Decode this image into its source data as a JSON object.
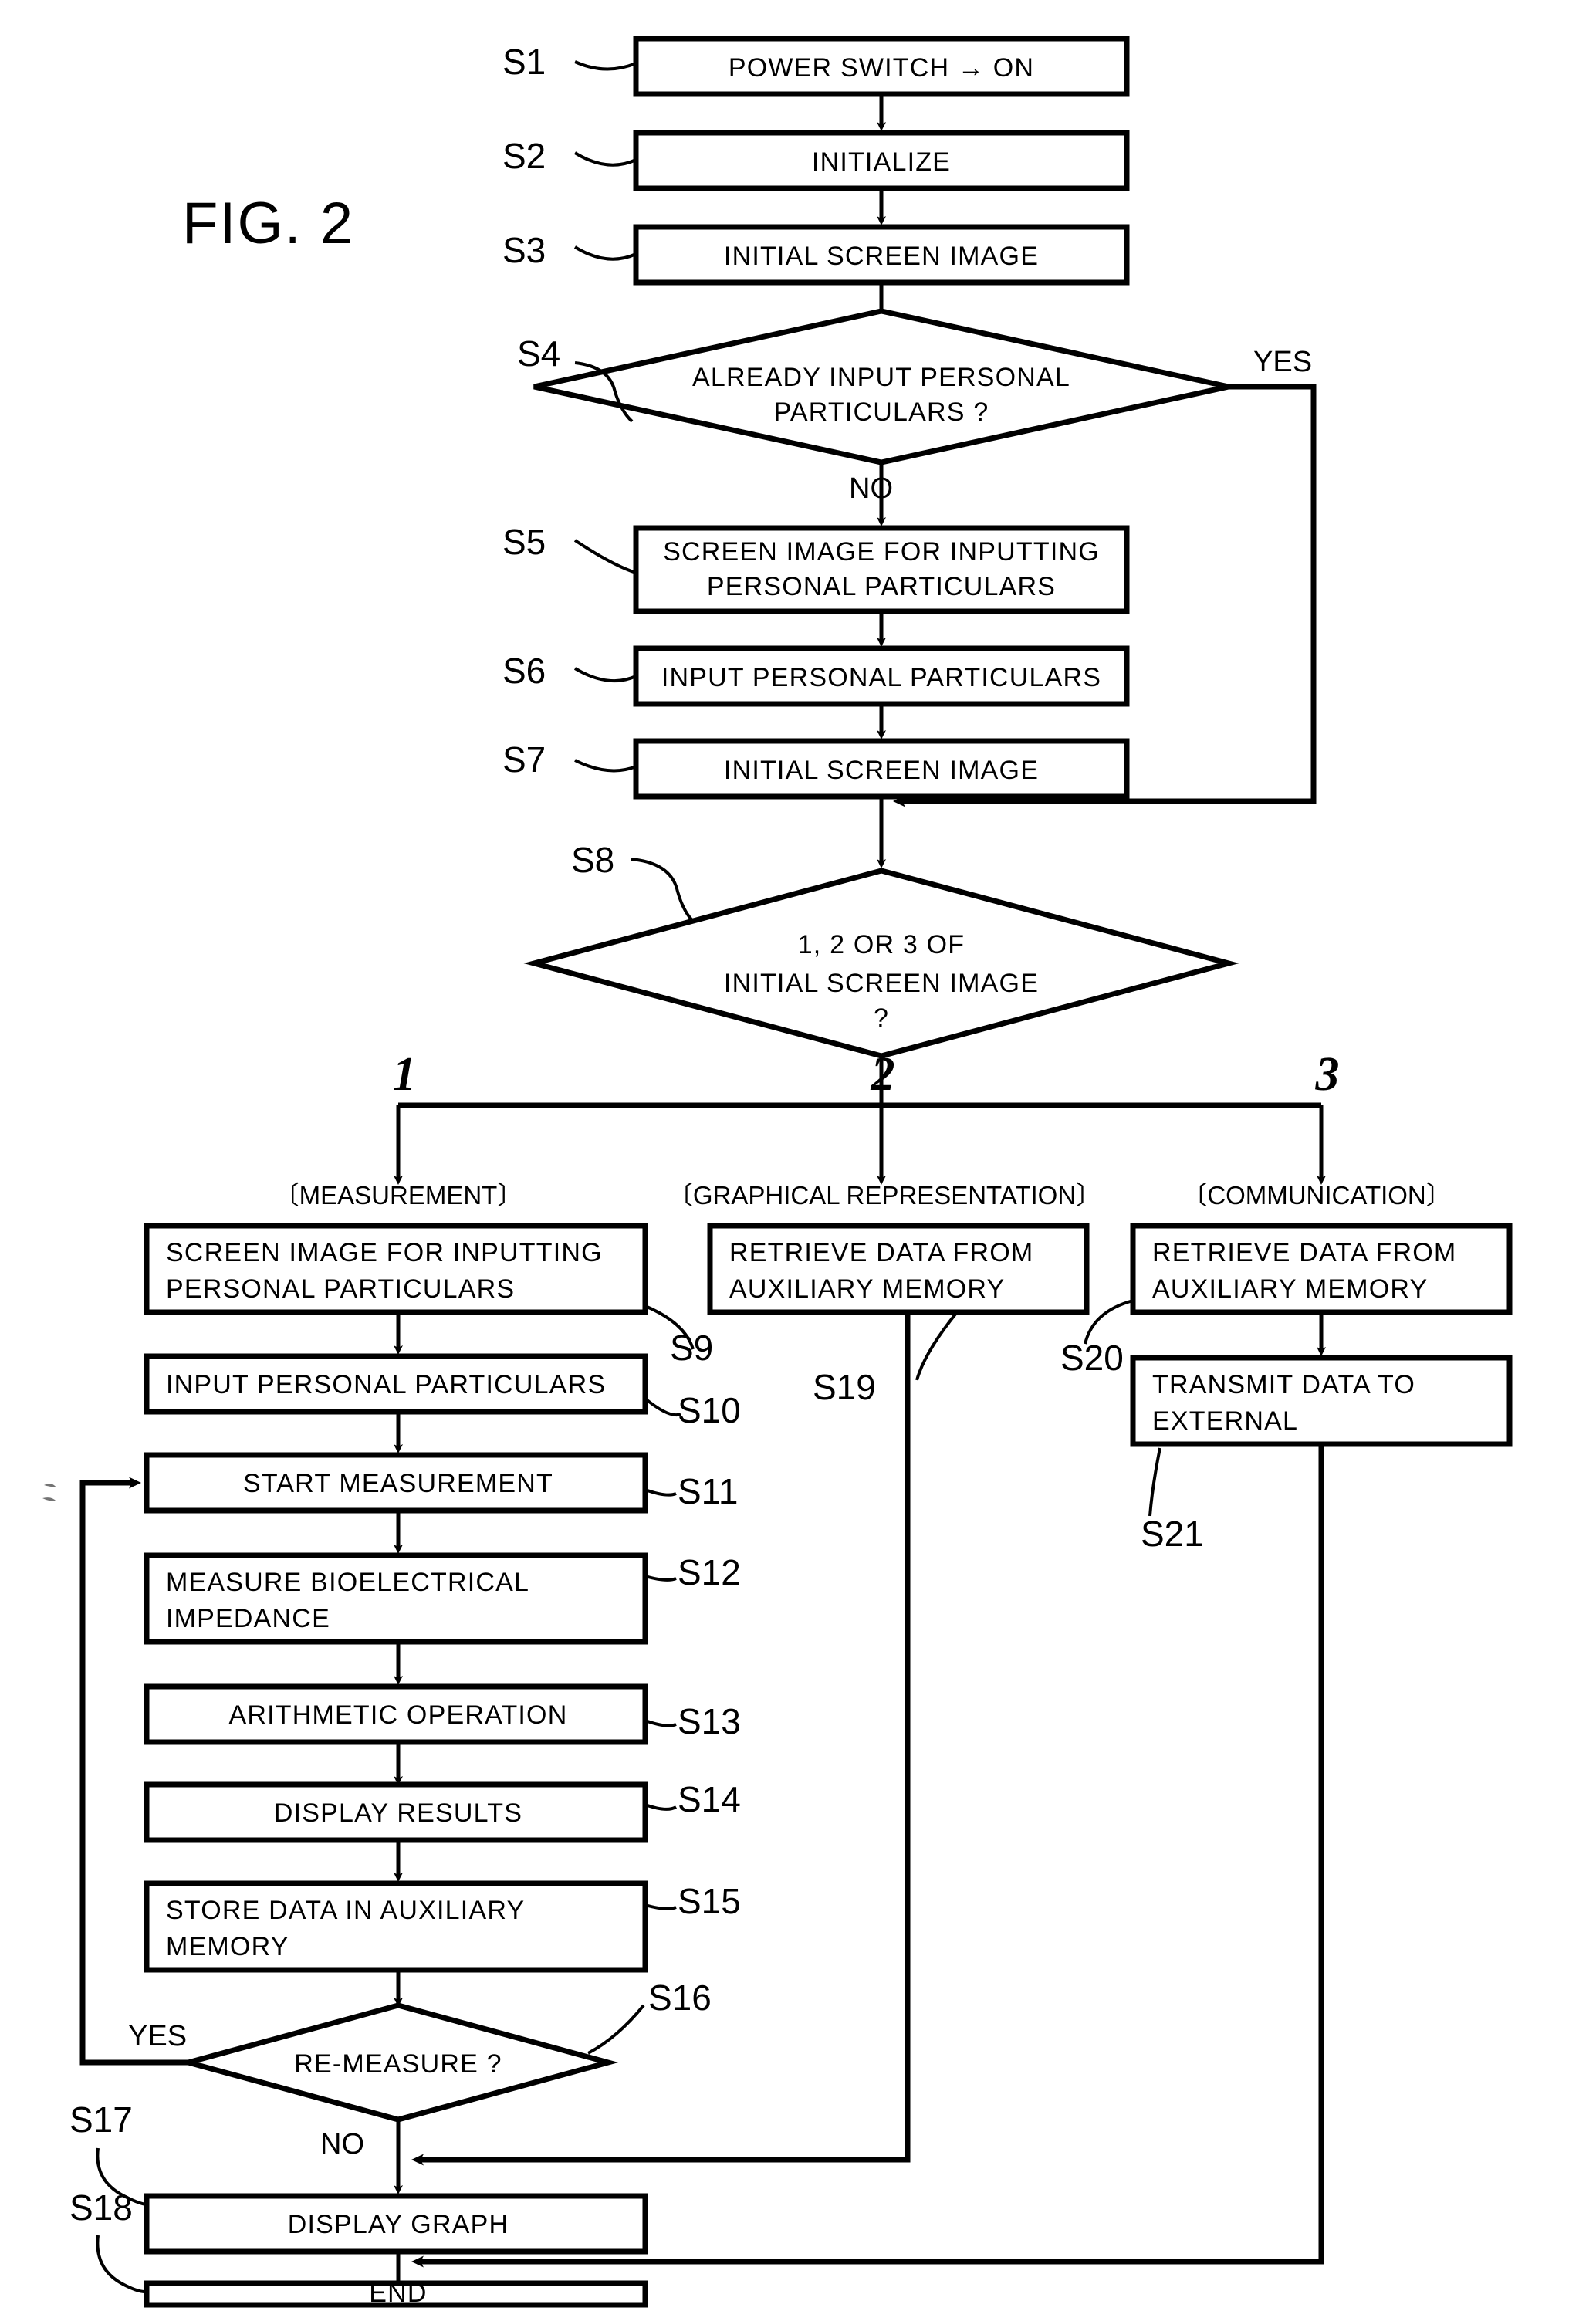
{
  "figure": {
    "title": "FIG. 2",
    "type": "flowchart"
  },
  "steps": {
    "s1": {
      "id": "S1",
      "text": "POWER SWITCH → ON"
    },
    "s2": {
      "id": "S2",
      "text": "INITIALIZE"
    },
    "s3": {
      "id": "S3",
      "text": "INITIAL SCREEN IMAGE"
    },
    "s4": {
      "id": "S4",
      "line1": "ALREADY INPUT PERSONAL",
      "line2": "PARTICULARS ?"
    },
    "s5": {
      "id": "S5",
      "line1": "SCREEN IMAGE FOR INPUTTING",
      "line2": "PERSONAL PARTICULARS"
    },
    "s6": {
      "id": "S6",
      "text": "INPUT PERSONAL PARTICULARS"
    },
    "s7": {
      "id": "S7",
      "text": "INITIAL SCREEN  IMAGE"
    },
    "s8": {
      "id": "S8",
      "line1": "1, 2 OR 3 OF",
      "line2": "INITIAL SCREEN   IMAGE",
      "line3": "?"
    },
    "s9": {
      "id": "S9",
      "line1": "SCREEN IMAGE FOR INPUTTING",
      "line2": "PERSONAL PARTICULARS"
    },
    "s10": {
      "id": "S10",
      "text": "INPUT PERSONAL PARTICULARS"
    },
    "s11": {
      "id": "S11",
      "text": "START  MEASUREMENT"
    },
    "s12": {
      "id": "S12",
      "line1": "MEASURE BIOELECTRICAL",
      "line2": "IMPEDANCE"
    },
    "s13": {
      "id": "S13",
      "text": "ARITHMETIC  OPERATION"
    },
    "s14": {
      "id": "S14",
      "text": "DISPLAY  RESULTS"
    },
    "s15": {
      "id": "S15",
      "line1": "STORE  DATA IN AUXILIARY",
      "line2": "MEMORY"
    },
    "s16": {
      "id": "S16",
      "text": "RE-MEASURE ?"
    },
    "s17": {
      "id": "S17",
      "text": "DISPLAY GRAPH"
    },
    "s18": {
      "id": "S18",
      "text": "END"
    },
    "s19": {
      "id": "S19",
      "line1": "RETRIEVE DATA FROM",
      "line2": "AUXILIARY MEMORY"
    },
    "s20": {
      "id": "S20",
      "line1": "RETRIEVE DATA FROM",
      "line2": "AUXILIARY MEMORY"
    },
    "s21": {
      "id": "S21",
      "line1": "TRANSMIT DATA TO",
      "line2": "EXTERNAL"
    }
  },
  "branches": {
    "one": {
      "number": "1",
      "heading": "〔MEASUREMENT〕"
    },
    "two": {
      "number": "2",
      "heading": "〔GRAPHICAL REPRESENTATION〕"
    },
    "three": {
      "number": "3",
      "heading": "〔COMMUNICATION〕"
    }
  },
  "edge_labels": {
    "s4_yes": "YES",
    "s4_no": "NO",
    "s16_yes": "YES",
    "s16_no": "NO"
  },
  "colors": {
    "ink": "#000000",
    "paper": "#ffffff"
  }
}
